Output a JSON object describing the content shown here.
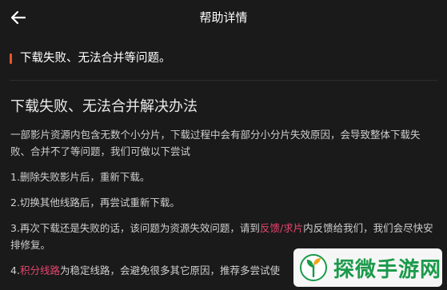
{
  "header": {
    "title": "帮助详情",
    "back_icon": "arrow-left-icon"
  },
  "question": {
    "text": "下载失败、无法合并等问题。",
    "accent_color": "#e8542a"
  },
  "article": {
    "title": "下载失败、无法合并解决办法",
    "intro": "一部影片资源内包含无数个小分片，下载过程中会有部分小分片失效原因，会导致整体下载失败、合并不了等问题，我们可做以下尝试",
    "step1": "1.删除失败影片后，重新下载。",
    "step2": "2.切换其他线路后，再尝试重新下载。",
    "step3": {
      "before": "3.再次下载还是失败的话，该问题为资源失效问题，请到",
      "link": "反馈/求片",
      "after": "内反馈给我们，我们会尽快安排修复。"
    },
    "step4": {
      "before": "4.",
      "link": "积分线路",
      "after": "为稳定线路，会避免很多其它原因，推荐多尝试使"
    },
    "link_color": "#e8456f"
  },
  "watermark": {
    "text": "探微手游网",
    "icon": "sprout-logo-icon",
    "color": "#1a9a4a"
  }
}
